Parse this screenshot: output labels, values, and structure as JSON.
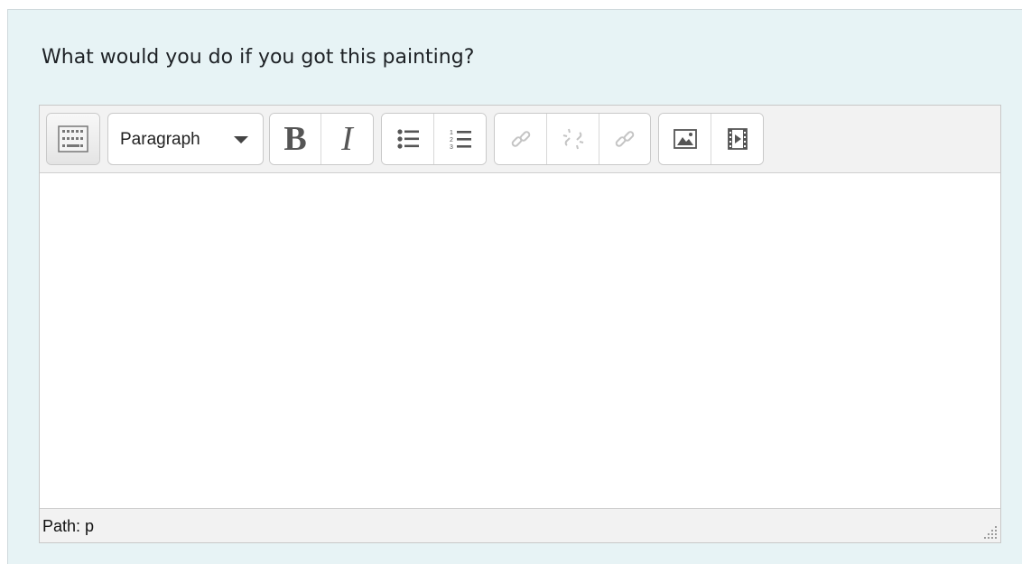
{
  "question": {
    "text": "What would you do if you got this painting?"
  },
  "toolbar": {
    "toggle_icon": "toolbar-toggle-icon",
    "block_format": {
      "selected": "Paragraph"
    },
    "bold_label": "B",
    "italic_label": "I",
    "icons": [
      "bullet-list-icon",
      "numbered-list-icon",
      "link-icon",
      "unlink-icon",
      "anchor-icon",
      "image-icon",
      "media-icon"
    ]
  },
  "editor": {
    "content": ""
  },
  "status": {
    "path": "Path: p"
  },
  "colors": {
    "panel_bg": "#e7f3f5",
    "toolbar_bg": "#f2f2f2",
    "disabled_icon": "#c4c4c4"
  }
}
